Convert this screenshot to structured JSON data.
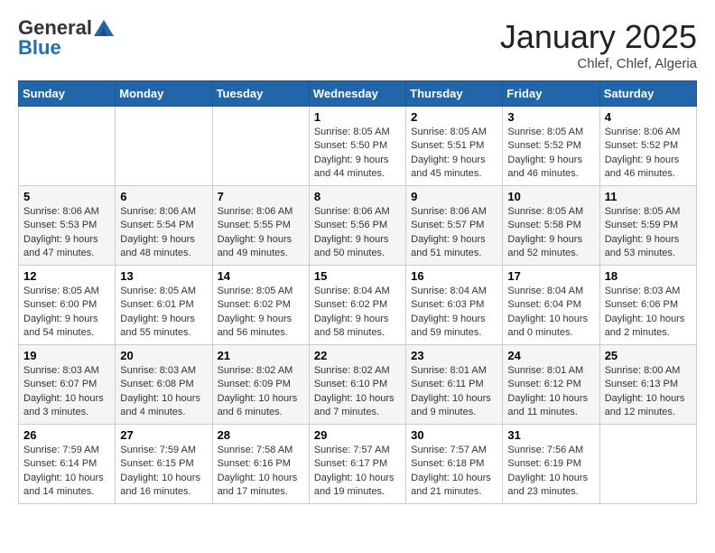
{
  "header": {
    "logo_general": "General",
    "logo_blue": "Blue",
    "title": "January 2025",
    "subtitle": "Chlef, Chlef, Algeria"
  },
  "weekdays": [
    "Sunday",
    "Monday",
    "Tuesday",
    "Wednesday",
    "Thursday",
    "Friday",
    "Saturday"
  ],
  "weeks": [
    [
      {
        "num": "",
        "detail": ""
      },
      {
        "num": "",
        "detail": ""
      },
      {
        "num": "",
        "detail": ""
      },
      {
        "num": "1",
        "detail": "Sunrise: 8:05 AM\nSunset: 5:50 PM\nDaylight: 9 hours\nand 44 minutes."
      },
      {
        "num": "2",
        "detail": "Sunrise: 8:05 AM\nSunset: 5:51 PM\nDaylight: 9 hours\nand 45 minutes."
      },
      {
        "num": "3",
        "detail": "Sunrise: 8:05 AM\nSunset: 5:52 PM\nDaylight: 9 hours\nand 46 minutes."
      },
      {
        "num": "4",
        "detail": "Sunrise: 8:06 AM\nSunset: 5:52 PM\nDaylight: 9 hours\nand 46 minutes."
      }
    ],
    [
      {
        "num": "5",
        "detail": "Sunrise: 8:06 AM\nSunset: 5:53 PM\nDaylight: 9 hours\nand 47 minutes."
      },
      {
        "num": "6",
        "detail": "Sunrise: 8:06 AM\nSunset: 5:54 PM\nDaylight: 9 hours\nand 48 minutes."
      },
      {
        "num": "7",
        "detail": "Sunrise: 8:06 AM\nSunset: 5:55 PM\nDaylight: 9 hours\nand 49 minutes."
      },
      {
        "num": "8",
        "detail": "Sunrise: 8:06 AM\nSunset: 5:56 PM\nDaylight: 9 hours\nand 50 minutes."
      },
      {
        "num": "9",
        "detail": "Sunrise: 8:06 AM\nSunset: 5:57 PM\nDaylight: 9 hours\nand 51 minutes."
      },
      {
        "num": "10",
        "detail": "Sunrise: 8:05 AM\nSunset: 5:58 PM\nDaylight: 9 hours\nand 52 minutes."
      },
      {
        "num": "11",
        "detail": "Sunrise: 8:05 AM\nSunset: 5:59 PM\nDaylight: 9 hours\nand 53 minutes."
      }
    ],
    [
      {
        "num": "12",
        "detail": "Sunrise: 8:05 AM\nSunset: 6:00 PM\nDaylight: 9 hours\nand 54 minutes."
      },
      {
        "num": "13",
        "detail": "Sunrise: 8:05 AM\nSunset: 6:01 PM\nDaylight: 9 hours\nand 55 minutes."
      },
      {
        "num": "14",
        "detail": "Sunrise: 8:05 AM\nSunset: 6:02 PM\nDaylight: 9 hours\nand 56 minutes."
      },
      {
        "num": "15",
        "detail": "Sunrise: 8:04 AM\nSunset: 6:02 PM\nDaylight: 9 hours\nand 58 minutes."
      },
      {
        "num": "16",
        "detail": "Sunrise: 8:04 AM\nSunset: 6:03 PM\nDaylight: 9 hours\nand 59 minutes."
      },
      {
        "num": "17",
        "detail": "Sunrise: 8:04 AM\nSunset: 6:04 PM\nDaylight: 10 hours\nand 0 minutes."
      },
      {
        "num": "18",
        "detail": "Sunrise: 8:03 AM\nSunset: 6:06 PM\nDaylight: 10 hours\nand 2 minutes."
      }
    ],
    [
      {
        "num": "19",
        "detail": "Sunrise: 8:03 AM\nSunset: 6:07 PM\nDaylight: 10 hours\nand 3 minutes."
      },
      {
        "num": "20",
        "detail": "Sunrise: 8:03 AM\nSunset: 6:08 PM\nDaylight: 10 hours\nand 4 minutes."
      },
      {
        "num": "21",
        "detail": "Sunrise: 8:02 AM\nSunset: 6:09 PM\nDaylight: 10 hours\nand 6 minutes."
      },
      {
        "num": "22",
        "detail": "Sunrise: 8:02 AM\nSunset: 6:10 PM\nDaylight: 10 hours\nand 7 minutes."
      },
      {
        "num": "23",
        "detail": "Sunrise: 8:01 AM\nSunset: 6:11 PM\nDaylight: 10 hours\nand 9 minutes."
      },
      {
        "num": "24",
        "detail": "Sunrise: 8:01 AM\nSunset: 6:12 PM\nDaylight: 10 hours\nand 11 minutes."
      },
      {
        "num": "25",
        "detail": "Sunrise: 8:00 AM\nSunset: 6:13 PM\nDaylight: 10 hours\nand 12 minutes."
      }
    ],
    [
      {
        "num": "26",
        "detail": "Sunrise: 7:59 AM\nSunset: 6:14 PM\nDaylight: 10 hours\nand 14 minutes."
      },
      {
        "num": "27",
        "detail": "Sunrise: 7:59 AM\nSunset: 6:15 PM\nDaylight: 10 hours\nand 16 minutes."
      },
      {
        "num": "28",
        "detail": "Sunrise: 7:58 AM\nSunset: 6:16 PM\nDaylight: 10 hours\nand 17 minutes."
      },
      {
        "num": "29",
        "detail": "Sunrise: 7:57 AM\nSunset: 6:17 PM\nDaylight: 10 hours\nand 19 minutes."
      },
      {
        "num": "30",
        "detail": "Sunrise: 7:57 AM\nSunset: 6:18 PM\nDaylight: 10 hours\nand 21 minutes."
      },
      {
        "num": "31",
        "detail": "Sunrise: 7:56 AM\nSunset: 6:19 PM\nDaylight: 10 hours\nand 23 minutes."
      },
      {
        "num": "",
        "detail": ""
      }
    ]
  ]
}
